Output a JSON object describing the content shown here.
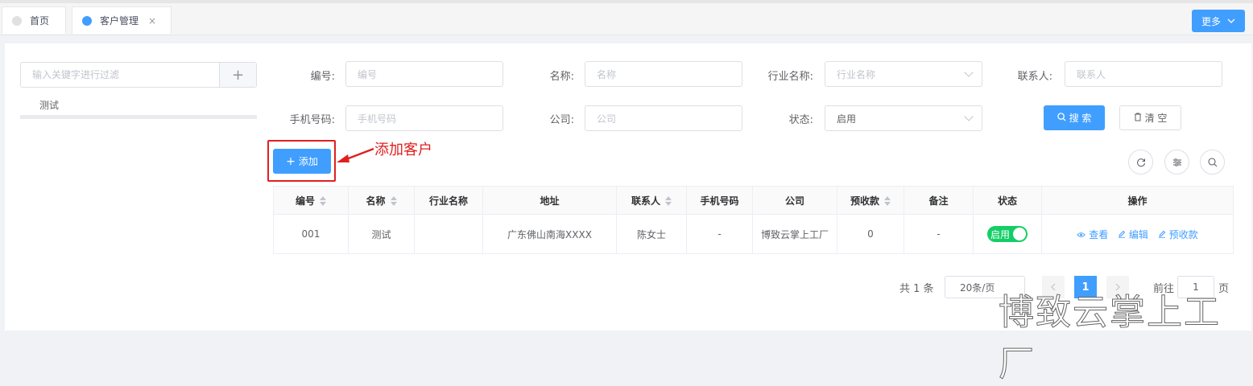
{
  "tabs": [
    {
      "label": "首页",
      "dot_color": "#e0e0e0",
      "closable": false
    },
    {
      "label": "客户管理",
      "dot_color": "#409eff",
      "closable": true
    }
  ],
  "tab_close_glyph": "×",
  "more_label": "更多",
  "tree": {
    "filter_placeholder": "输入关键字进行过滤",
    "add_glyph": "+",
    "nodes": [
      "测试"
    ]
  },
  "filters": {
    "code": {
      "label": "编号:",
      "placeholder": "编号"
    },
    "name": {
      "label": "名称:",
      "placeholder": "名称"
    },
    "industry": {
      "label": "行业名称:",
      "placeholder": "行业名称"
    },
    "contact": {
      "label": "联系人:",
      "placeholder": "联系人"
    },
    "phone": {
      "label": "手机号码:",
      "placeholder": "手机号码"
    },
    "company": {
      "label": "公司:",
      "placeholder": "公司"
    },
    "status": {
      "label": "状态:",
      "value": "启用"
    }
  },
  "buttons": {
    "search": "搜 索",
    "clear": "清 空",
    "add": "添加"
  },
  "annotation": "添加客户",
  "table": {
    "headers": [
      "编号",
      "名称",
      "行业名称",
      "地址",
      "联系人",
      "手机号码",
      "公司",
      "预收款",
      "备注",
      "状态",
      "操作"
    ],
    "rows": [
      {
        "code": "001",
        "name": "测试",
        "industry": "",
        "address": "广东佛山南海XXXX",
        "contact": "陈女士",
        "phone": "-",
        "company": "博致云掌上工厂",
        "prepay": "0",
        "remark": "-",
        "status": "启用",
        "actions": [
          "查看",
          "编辑",
          "预收款"
        ]
      }
    ]
  },
  "pagination": {
    "total": "共 1 条",
    "page_size": "20条/页",
    "current": "1",
    "goto_prefix": "前往",
    "goto_value": "1",
    "goto_suffix": "页"
  },
  "watermark": "博致云掌上工厂",
  "colors": {
    "primary": "#409eff",
    "success": "#13ce66",
    "annotation": "#e02020"
  }
}
